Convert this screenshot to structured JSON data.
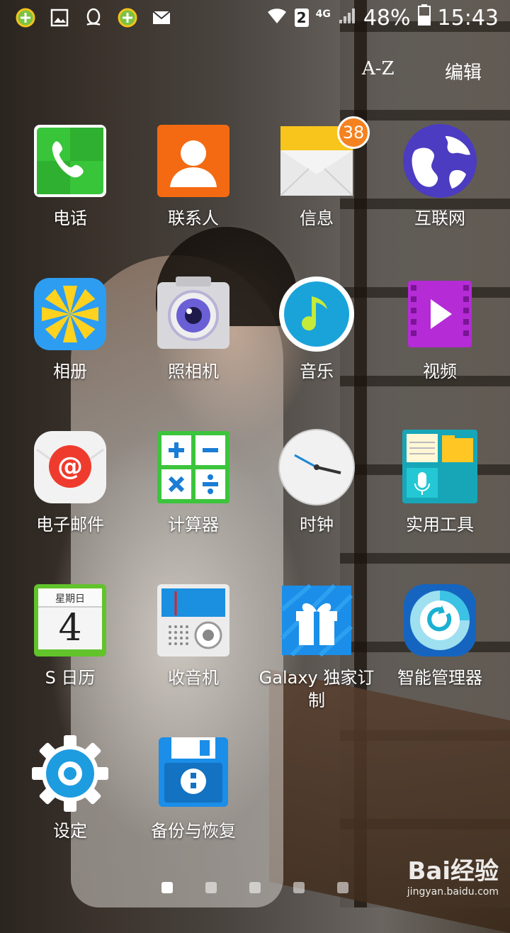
{
  "status_bar": {
    "sim_slot": "2",
    "network": "4G",
    "battery": "48%",
    "time": "15:43",
    "left_icons": [
      "360-security-icon",
      "gallery-icon",
      "qq-icon",
      "360-security-icon",
      "mail-icon"
    ]
  },
  "top_actions": {
    "sort": "A-Z",
    "edit": "编辑"
  },
  "apps": [
    {
      "label": "电话"
    },
    {
      "label": "联系人"
    },
    {
      "label": "信息",
      "badge": "38"
    },
    {
      "label": "互联网"
    },
    {
      "label": "相册"
    },
    {
      "label": "照相机"
    },
    {
      "label": "音乐"
    },
    {
      "label": "视频"
    },
    {
      "label": "电子邮件"
    },
    {
      "label": "计算器"
    },
    {
      "label": "时钟"
    },
    {
      "label": "实用工具"
    },
    {
      "label": "S 日历",
      "icon_text_top": "星期日",
      "icon_text_num": "4"
    },
    {
      "label": "收音机"
    },
    {
      "label": "Galaxy 独家订制"
    },
    {
      "label": "智能管理器"
    },
    {
      "label": "设定"
    },
    {
      "label": "备份与恢复"
    }
  ],
  "pages": {
    "count": 5,
    "active": 1
  },
  "watermark": {
    "logo": "Bai经验",
    "url": "jingyan.baidu.com"
  }
}
